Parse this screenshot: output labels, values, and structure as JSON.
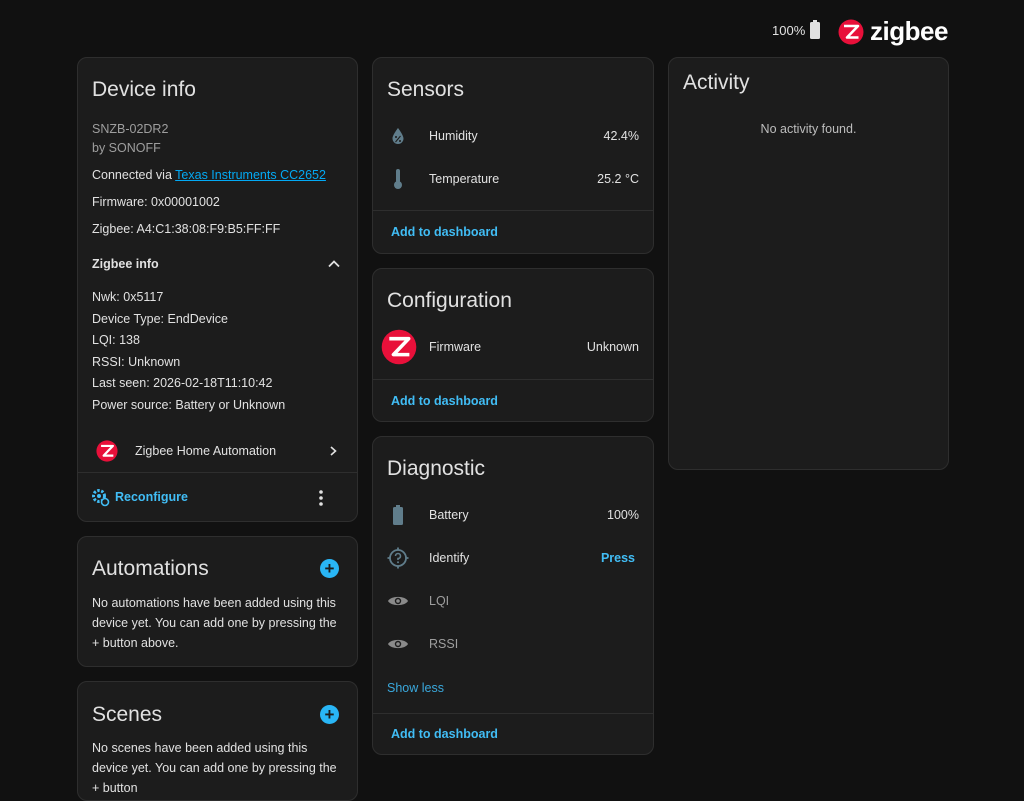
{
  "header": {
    "battery": "100%",
    "brand": "zigbee"
  },
  "device_info": {
    "title": "Device info",
    "model": "SNZB-02DR2",
    "manufacturer": "by SONOFF",
    "connected_prefix": "Connected via ",
    "connected_link": "Texas Instruments CC2652",
    "firmware": "Firmware: 0x00001002",
    "zigbee": "Zigbee: A4:C1:38:08:F9:B5:FF:FF",
    "zigbee_info_label": "Zigbee info",
    "nwk": "Nwk: 0x5117",
    "device_type": "Device Type: EndDevice",
    "lqi": "LQI: 138",
    "rssi": "RSSI: Unknown",
    "last_seen": "Last seen: 2026-02-18T11:10:42",
    "power_source": "Power source: Battery or Unknown",
    "integration": "Zigbee Home Automation",
    "reconfigure": "Reconfigure"
  },
  "automations": {
    "title": "Automations",
    "text": "No automations have been added using this device yet. You can add one by pressing the + button above."
  },
  "scenes": {
    "title": "Scenes",
    "text": "No scenes have been added using this device yet. You can add one by pressing the + button"
  },
  "sensors": {
    "title": "Sensors",
    "rows": [
      {
        "label": "Humidity",
        "value": "42.4%",
        "icon": "water-percent-icon"
      },
      {
        "label": "Temperature",
        "value": "25.2 °C",
        "icon": "thermometer-icon"
      }
    ],
    "add": "Add to dashboard"
  },
  "configuration": {
    "title": "Configuration",
    "rows": [
      {
        "label": "Firmware",
        "value": "Unknown",
        "icon": "zigbee-logo-icon"
      }
    ],
    "add": "Add to dashboard"
  },
  "diagnostic": {
    "title": "Diagnostic",
    "rows": [
      {
        "label": "Battery",
        "value": "100%",
        "icon": "battery-icon"
      },
      {
        "label": "Identify",
        "value": "Press",
        "icon": "help-circle-icon"
      },
      {
        "label": "LQI",
        "value": "",
        "icon": "eye-icon"
      },
      {
        "label": "RSSI",
        "value": "",
        "icon": "eye-icon"
      }
    ],
    "show_less": "Show less",
    "add": "Add to dashboard"
  },
  "activity": {
    "title": "Activity",
    "empty": "No activity found."
  },
  "colors": {
    "accent": "#41bdf5",
    "zigbee_red": "#e8103a",
    "card_bg": "#1c1c1c",
    "page_bg": "#111111"
  }
}
